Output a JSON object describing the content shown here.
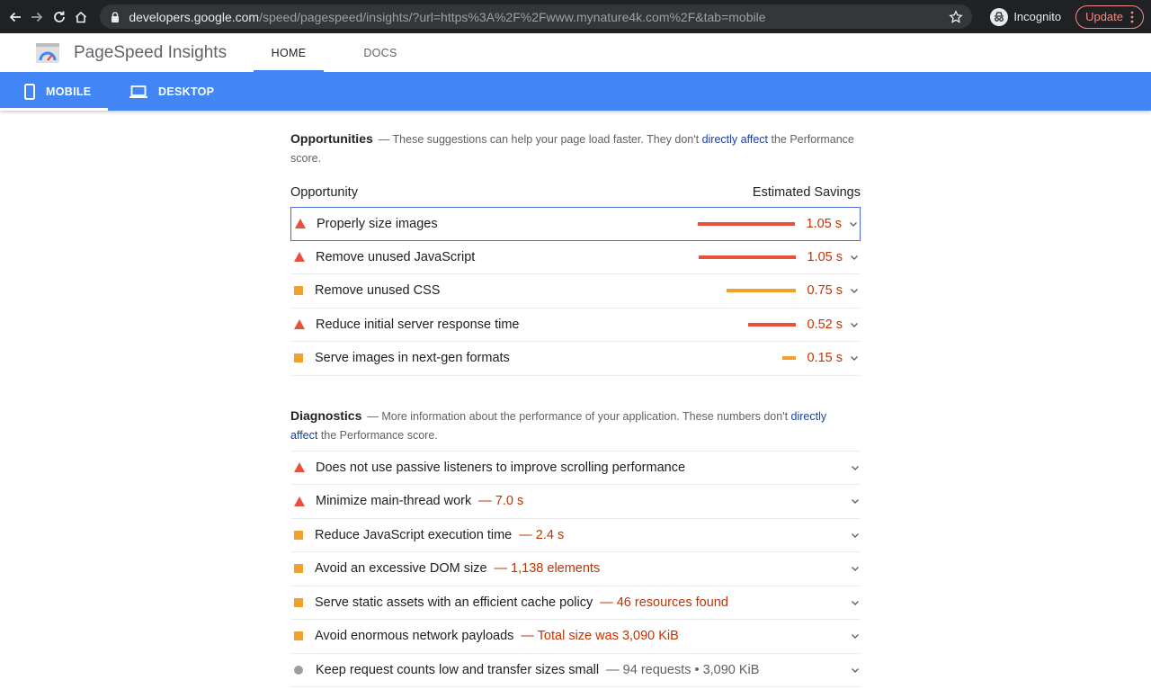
{
  "browser": {
    "url_host": "developers.google.com",
    "url_path": "/speed/pagespeed/insights/?url=https%3A%2F%2Fwww.mynature4k.com%2F&tab=mobile",
    "incognito_label": "Incognito",
    "update_label": "Update"
  },
  "header": {
    "app_title": "PageSpeed Insights",
    "tabs": [
      {
        "label": "HOME"
      },
      {
        "label": "DOCS"
      }
    ]
  },
  "device_tabs": [
    {
      "label": "MOBILE"
    },
    {
      "label": "DESKTOP"
    }
  ],
  "opportunities": {
    "title": "Opportunities",
    "desc_before": "— These suggestions can help your page load faster. They don't ",
    "desc_link": "directly affect",
    "desc_after": " the Performance score.",
    "col_left": "Opportunity",
    "col_right": "Estimated Savings",
    "items": [
      {
        "label": "Properly size images",
        "savings": "1.05 s",
        "level": "fail",
        "bar_fraction": 1.0
      },
      {
        "label": "Remove unused JavaScript",
        "savings": "1.05 s",
        "level": "fail",
        "bar_fraction": 1.0
      },
      {
        "label": "Remove unused CSS",
        "savings": "0.75 s",
        "level": "average",
        "bar_fraction": 0.71
      },
      {
        "label": "Reduce initial server response time",
        "savings": "0.52 s",
        "level": "fail",
        "bar_fraction": 0.49
      },
      {
        "label": "Serve images in next-gen formats",
        "savings": "0.15 s",
        "level": "average",
        "bar_fraction": 0.14
      }
    ]
  },
  "diagnostics": {
    "title": "Diagnostics",
    "desc_before": "— More information about the performance of your application. These numbers don't ",
    "desc_link1": "directly",
    "desc_link2": "affect",
    "desc_after": " the Performance score.",
    "items": [
      {
        "label": "Does not use passive listeners to improve scrolling performance",
        "extra": "",
        "level": "fail"
      },
      {
        "label": "Minimize main-thread work",
        "extra": "— 7.0 s",
        "level": "fail"
      },
      {
        "label": "Reduce JavaScript execution time",
        "extra": "— 2.4 s",
        "level": "average"
      },
      {
        "label": "Avoid an excessive DOM size",
        "extra": "— 1,138 elements",
        "level": "average"
      },
      {
        "label": "Serve static assets with an efficient cache policy",
        "extra": "— 46 resources found",
        "level": "average"
      },
      {
        "label": "Avoid enormous network payloads",
        "extra": "— Total size was 3,090 KiB",
        "level": "average"
      },
      {
        "label": "Keep request counts low and transfer sizes small",
        "extra": "— 94 requests • 3,090 KiB",
        "level": "info"
      }
    ]
  }
}
